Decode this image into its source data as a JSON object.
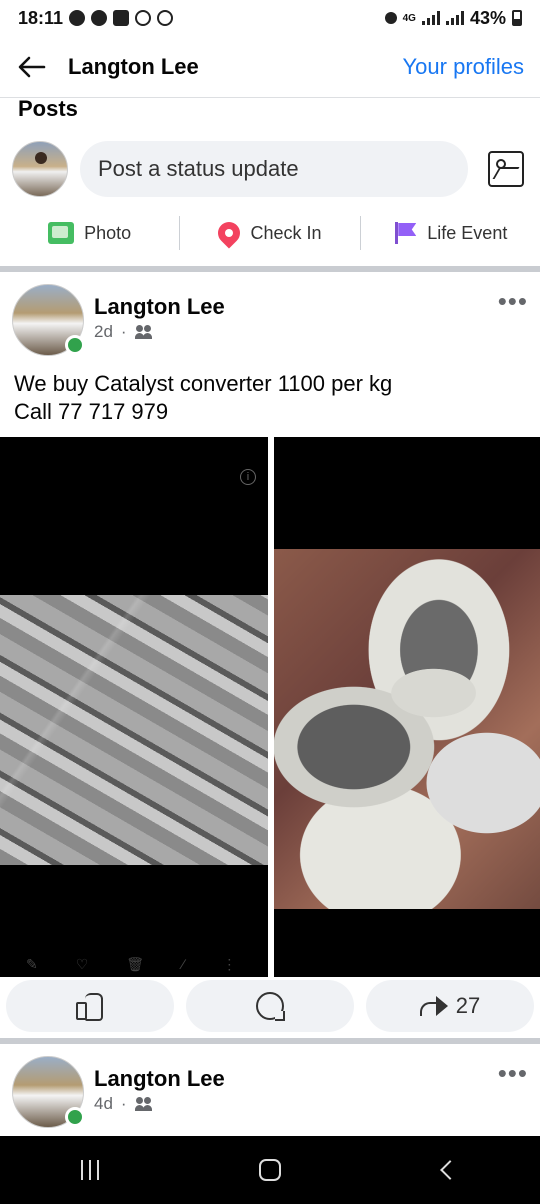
{
  "status_bar": {
    "time": "18:11",
    "battery": "43%",
    "network": "4G"
  },
  "header": {
    "title": "Langton Lee",
    "right_link": "Your profiles"
  },
  "section_label": "Posts",
  "composer": {
    "placeholder": "Post a status update"
  },
  "composer_actions": [
    {
      "label": "Photo",
      "icon": "photo-icon"
    },
    {
      "label": "Check In",
      "icon": "location-pin-icon"
    },
    {
      "label": "Life Event",
      "icon": "flag-icon"
    }
  ],
  "posts": [
    {
      "author": "Langton Lee",
      "time": "2d",
      "audience_icon": "friends-icon",
      "text": "We buy Catalyst converter 1100 per kg\nCall 77 717 979",
      "share_count": "27"
    },
    {
      "author": "Langton Lee",
      "time": "4d",
      "audience_icon": "friends-icon"
    }
  ],
  "colors": {
    "accent": "#1877f2",
    "online": "#31a24c",
    "divider": "#c9ccd1"
  }
}
